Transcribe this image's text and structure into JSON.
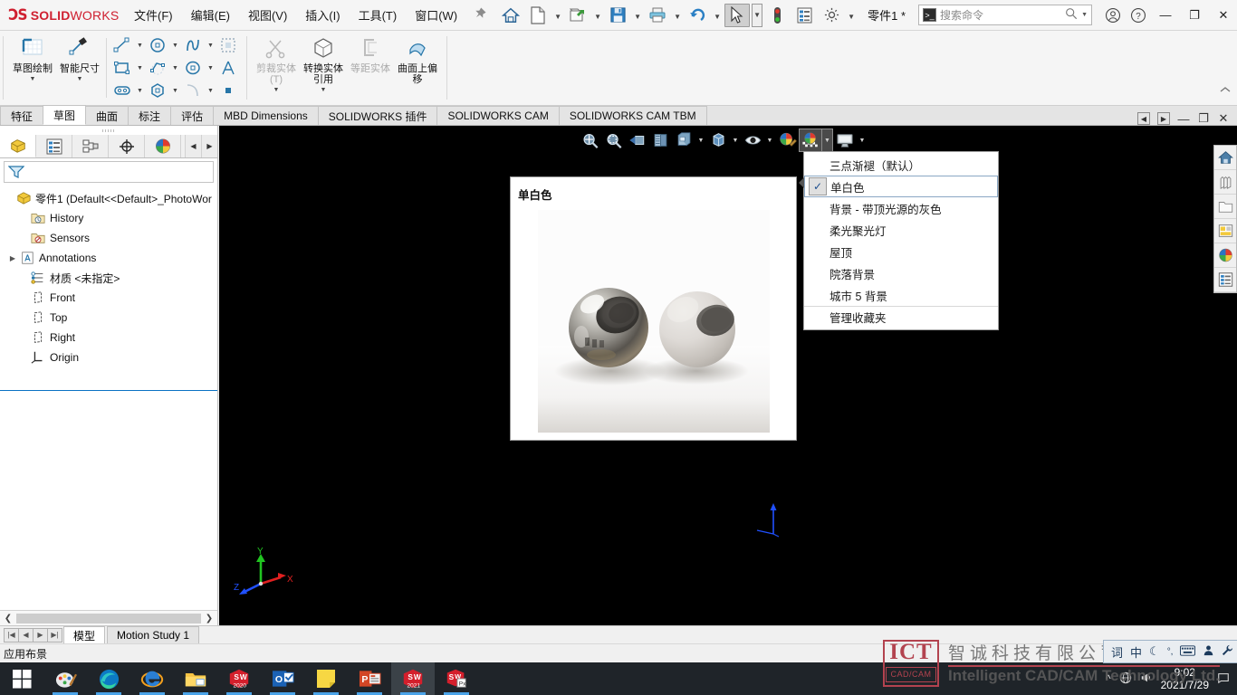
{
  "titlebar": {
    "brand_ds": "ƆS",
    "brand_bold": "SOLID",
    "brand_light": "WORKS",
    "menus": [
      {
        "label": "文件(F)"
      },
      {
        "label": "编辑(E)"
      },
      {
        "label": "视图(V)"
      },
      {
        "label": "插入(I)"
      },
      {
        "label": "工具(T)"
      },
      {
        "label": "窗口(W)"
      }
    ],
    "pin_icon": "pin-icon",
    "quick_access": [
      {
        "name": "home-button",
        "icon": "home-icon",
        "dropdown": false
      },
      {
        "name": "new-document-button",
        "icon": "new-file-icon",
        "dropdown": true
      },
      {
        "name": "open-document-button",
        "icon": "open-folder-icon",
        "dropdown": true
      },
      {
        "name": "save-button",
        "icon": "save-floppy-icon",
        "dropdown": true
      },
      {
        "name": "print-button",
        "icon": "printer-icon",
        "dropdown": true
      },
      {
        "name": "undo-button",
        "icon": "undo-arrow-icon",
        "dropdown": true
      },
      {
        "name": "select-tool-button",
        "icon": "cursor-arrow-icon",
        "dropdown": true,
        "active": true
      },
      {
        "name": "rebuild-button",
        "icon": "traffic-light-icon",
        "dropdown": false
      },
      {
        "name": "file-properties-button",
        "icon": "properties-list-icon",
        "dropdown": false
      },
      {
        "name": "options-button",
        "icon": "gear-icon",
        "dropdown": true
      }
    ],
    "document_name": "零件1 *",
    "search": {
      "placeholder": "搜索命令",
      "command_icon": "command-prompt-icon",
      "search_icon": "search-icon",
      "dropdown_icon": "chevron-down-icon"
    },
    "right_buttons": [
      {
        "name": "user-account-button",
        "icon": "user-circle-icon"
      },
      {
        "name": "help-button",
        "icon": "question-circle-icon"
      }
    ],
    "window_buttons": [
      {
        "name": "minimize-button",
        "icon": "minimize-icon",
        "glyph": "—"
      },
      {
        "name": "restore-button",
        "icon": "restore-icon",
        "glyph": "❐"
      },
      {
        "name": "close-button",
        "icon": "close-icon",
        "glyph": "✕"
      }
    ]
  },
  "ribbon": {
    "groups": [
      {
        "name": "sketch-group",
        "big_buttons": [
          {
            "name": "sketch-button",
            "label": "草图绘制",
            "icon": "sketch-icon",
            "dropdown": true,
            "disabled": false
          },
          {
            "name": "smart-dimension-button",
            "label": "智能尺寸",
            "icon": "smart-dimension-icon",
            "dropdown": true,
            "disabled": false
          }
        ],
        "small_buttons": [
          {
            "name": "line-button",
            "icon": "line-icon",
            "dropdown": true
          },
          {
            "name": "circle-button",
            "icon": "circle-icon",
            "dropdown": true
          },
          {
            "name": "spline-button",
            "icon": "spline-icon",
            "dropdown": true
          },
          {
            "name": "trim-entities-button",
            "icon": "dashed-rect-icon",
            "dropdown": false
          },
          {
            "name": "rectangle-button",
            "icon": "rectangle-icon",
            "dropdown": true
          },
          {
            "name": "polygon-arc-button",
            "icon": "arc-slot-icon",
            "dropdown": true
          },
          {
            "name": "ellipse-button",
            "icon": "ellipse-icon",
            "dropdown": true
          },
          {
            "name": "text-button",
            "icon": "text-A-icon",
            "dropdown": false
          },
          {
            "name": "slot-button",
            "icon": "slot-icon",
            "dropdown": true
          },
          {
            "name": "hexagon-button",
            "icon": "hexagon-icon",
            "dropdown": true
          },
          {
            "name": "fillet-button",
            "icon": "sketch-fillet-icon",
            "dropdown": true
          },
          {
            "name": "point-button",
            "icon": "point-icon",
            "dropdown": false
          }
        ]
      },
      {
        "name": "entity-tools-group",
        "big_buttons": [
          {
            "name": "trim-entities-button",
            "label": "剪裁实体(T)",
            "icon": "trim-icon",
            "dropdown": true,
            "disabled": true
          },
          {
            "name": "convert-entities-button",
            "label": "转换实体引用",
            "icon": "convert-entities-icon",
            "dropdown": true,
            "disabled": false
          },
          {
            "name": "offset-entities-button",
            "label": "等距实体",
            "icon": "offset-entities-icon",
            "dropdown": false,
            "disabled": true
          },
          {
            "name": "offset-on-surface-button",
            "label": "曲面上偏移",
            "icon": "offset-on-surface-icon",
            "dropdown": false,
            "disabled": false
          }
        ],
        "small_buttons": []
      }
    ],
    "collapse_icon": "chevron-up-icon"
  },
  "tabs": [
    {
      "label": "特征",
      "active": false
    },
    {
      "label": "草图",
      "active": true
    },
    {
      "label": "曲面",
      "active": false
    },
    {
      "label": "标注",
      "active": false
    },
    {
      "label": "评估",
      "active": false
    },
    {
      "label": "MBD Dimensions",
      "active": false
    },
    {
      "label": "SOLIDWORKS 插件",
      "active": false
    },
    {
      "label": "SOLIDWORKS CAM",
      "active": false
    },
    {
      "label": "SOLIDWORKS CAM TBM",
      "active": false
    }
  ],
  "left_panel": {
    "tabs": [
      {
        "name": "feature-manager-tab",
        "icon": "feature-tree-icon",
        "active": true
      },
      {
        "name": "property-manager-tab",
        "icon": "property-list-icon",
        "active": false
      },
      {
        "name": "configuration-manager-tab",
        "icon": "configuration-icon",
        "active": false
      },
      {
        "name": "dimxpert-manager-tab",
        "icon": "dimxpert-icon",
        "active": false
      },
      {
        "name": "display-manager-tab",
        "icon": "display-sphere-icon",
        "active": false
      }
    ],
    "nav_prev_icon": "chevron-left-icon",
    "nav_next_icon": "chevron-right-icon",
    "filter_icon": "filter-funnel-icon",
    "tree": [
      {
        "label": "零件1  (Default<<Default>_PhotoWor",
        "icon": "part-icon",
        "indent": 0,
        "twist": false
      },
      {
        "label": "History",
        "icon": "history-folder-icon",
        "indent": 1,
        "twist": false
      },
      {
        "label": "Sensors",
        "icon": "sensors-icon",
        "indent": 1,
        "twist": false
      },
      {
        "label": "Annotations",
        "icon": "annotations-icon",
        "indent": 1,
        "twist": true
      },
      {
        "label": "材质 <未指定>",
        "icon": "material-icon",
        "indent": 1,
        "twist": false
      },
      {
        "label": "Front",
        "icon": "plane-icon",
        "indent": 1,
        "twist": false
      },
      {
        "label": "Top",
        "icon": "plane-icon",
        "indent": 1,
        "twist": false
      },
      {
        "label": "Right",
        "icon": "plane-icon",
        "indent": 1,
        "twist": false
      },
      {
        "label": "Origin",
        "icon": "origin-icon",
        "indent": 1,
        "twist": false
      }
    ],
    "hscroll_left_icon": "chevron-left-icon",
    "hscroll_right_icon": "chevron-right-icon"
  },
  "view_toolbar": [
    {
      "name": "zoom-to-fit-button",
      "icon": "zoom-to-fit-icon",
      "dropdown": false,
      "pressed": false
    },
    {
      "name": "zoom-to-area-button",
      "icon": "zoom-to-area-icon",
      "dropdown": false,
      "pressed": false
    },
    {
      "name": "previous-view-button",
      "icon": "previous-view-icon",
      "dropdown": false,
      "pressed": false
    },
    {
      "name": "section-view-button",
      "icon": "section-view-icon",
      "dropdown": false,
      "pressed": false
    },
    {
      "name": "view-orientation-button",
      "icon": "view-orientation-icon",
      "dropdown": true,
      "pressed": false
    },
    {
      "name": "display-style-button",
      "icon": "display-style-icon",
      "dropdown": true,
      "pressed": false
    },
    {
      "name": "hide-show-items-button",
      "icon": "eye-icon",
      "dropdown": true,
      "pressed": false
    },
    {
      "name": "edit-appearance-button",
      "icon": "appearance-sphere-icon",
      "dropdown": false,
      "pressed": false
    },
    {
      "name": "apply-scene-button",
      "icon": "apply-scene-icon",
      "dropdown": true,
      "pressed": true
    },
    {
      "name": "view-settings-button",
      "icon": "view-settings-icon",
      "dropdown": true,
      "pressed": false
    }
  ],
  "view_window_buttons": [
    {
      "name": "restore-pane-left-icon",
      "glyph": "◀"
    },
    {
      "name": "restore-pane-right-icon",
      "glyph": "▶"
    },
    {
      "name": "doc-minimize-button",
      "glyph": "—"
    },
    {
      "name": "doc-restore-button",
      "glyph": "❐"
    },
    {
      "name": "doc-close-button",
      "glyph": "✕"
    }
  ],
  "scene_menu": {
    "items": [
      {
        "label": "三点渐褪（默认）",
        "checked": false,
        "divider": false
      },
      {
        "label": "单白色",
        "checked": true,
        "divider": false
      },
      {
        "label": "背景 - 带顶光源的灰色",
        "checked": false,
        "divider": false
      },
      {
        "label": "柔光聚光灯",
        "checked": false,
        "divider": false
      },
      {
        "label": "屋顶",
        "checked": false,
        "divider": false
      },
      {
        "label": "院落背景",
        "checked": false,
        "divider": false
      },
      {
        "label": "城市 5 背景",
        "checked": false,
        "divider": false
      },
      {
        "label": "管理收藏夹",
        "checked": false,
        "divider": true
      }
    ]
  },
  "preview": {
    "title": "单白色",
    "image_name": "scene-preview-two-spheres"
  },
  "task_pane": [
    {
      "name": "task-pane-home-button",
      "icon": "home-icon"
    },
    {
      "name": "task-pane-design-library-button",
      "icon": "design-library-icon"
    },
    {
      "name": "task-pane-file-explorer-button",
      "icon": "folder-icon"
    },
    {
      "name": "task-pane-view-palette-button",
      "icon": "view-palette-icon"
    },
    {
      "name": "task-pane-appearances-scenes-button",
      "icon": "appearances-sphere-icon"
    },
    {
      "name": "task-pane-custom-properties-button",
      "icon": "custom-properties-icon"
    }
  ],
  "viewport": {
    "triad_labels": {
      "x": "X",
      "y": "Y",
      "z": "Z"
    },
    "triad_colors": {
      "x": "#e02020",
      "y": "#21c421",
      "z": "#2050ff"
    },
    "background": "#000000"
  },
  "document_bar": {
    "nav_buttons": [
      {
        "name": "first-tab-button",
        "glyph": "|◀"
      },
      {
        "name": "prev-tab-button",
        "glyph": "◀"
      },
      {
        "name": "next-tab-button",
        "glyph": "▶"
      },
      {
        "name": "last-tab-button",
        "glyph": "▶|"
      }
    ],
    "tabs": [
      {
        "label": "模型",
        "active": true
      },
      {
        "label": "Motion Study 1",
        "active": false
      }
    ]
  },
  "status_bar": {
    "message": "应用布景"
  },
  "watermark": {
    "logo_text": "ICT",
    "logo_sub": "CAD/CAM",
    "chinese": "智诚科技有限公司",
    "english": "Intelligent CAD/CAM Technology Ltd."
  },
  "taskbar": {
    "start_icon": "windows-start-icon",
    "apps": [
      {
        "name": "taskbar-paint3d",
        "icon": "paint-palette-icon",
        "active": false
      },
      {
        "name": "taskbar-edge",
        "icon": "edge-browser-icon",
        "active": false
      },
      {
        "name": "taskbar-internet-explorer",
        "icon": "ie-browser-icon",
        "active": false
      },
      {
        "name": "taskbar-file-explorer",
        "icon": "folder-icon",
        "active": false
      },
      {
        "name": "taskbar-solidworks-2020",
        "icon": "solidworks-2020-icon",
        "label": "2020",
        "active": false
      },
      {
        "name": "taskbar-outlook",
        "icon": "outlook-icon",
        "active": false
      },
      {
        "name": "taskbar-sticky-notes",
        "icon": "sticky-note-icon",
        "active": false
      },
      {
        "name": "taskbar-powerpoint",
        "icon": "powerpoint-icon",
        "active": false
      },
      {
        "name": "taskbar-solidworks-2021",
        "icon": "solidworks-2021-icon",
        "label": "2021",
        "active": true
      },
      {
        "name": "taskbar-solidworks-explorer",
        "icon": "solidworks-explorer-icon",
        "active": false
      }
    ],
    "ime": {
      "lang": "中",
      "items": [
        {
          "name": "ime-logo-icon",
          "glyph": "词"
        },
        {
          "name": "ime-language-label",
          "glyph": "中"
        },
        {
          "name": "ime-moon-icon",
          "glyph": "☾"
        },
        {
          "name": "ime-punctuation-icon",
          "glyph": "°,"
        },
        {
          "name": "ime-keyboard-icon",
          "glyph": "⌨"
        },
        {
          "name": "ime-user-icon",
          "glyph": "👤"
        },
        {
          "name": "ime-tools-icon",
          "glyph": "🔧"
        }
      ]
    },
    "tray": {
      "time": "9:02",
      "date": "2021/7/29",
      "icons": [
        {
          "name": "tray-show-hidden-icon",
          "glyph": "^"
        },
        {
          "name": "tray-network-icon",
          "glyph": "🌐"
        },
        {
          "name": "tray-volume-icon",
          "glyph": "🔊"
        },
        {
          "name": "tray-action-center-icon",
          "glyph": "▤"
        }
      ]
    }
  }
}
